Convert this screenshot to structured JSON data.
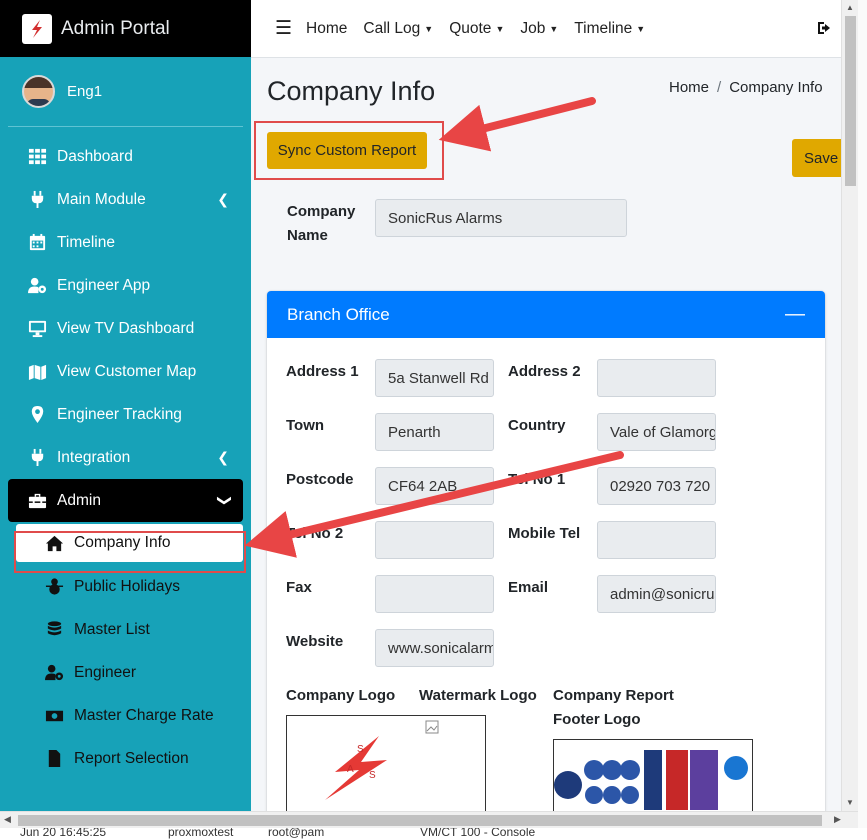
{
  "brand": {
    "title": "Admin Portal"
  },
  "user": {
    "name": "Eng1"
  },
  "sidebar": {
    "items": [
      {
        "label": "Dashboard",
        "icon": "dashboard-icon"
      },
      {
        "label": "Main Module",
        "icon": "plug-icon"
      },
      {
        "label": "Timeline",
        "icon": "calendar-icon"
      },
      {
        "label": "Engineer App",
        "icon": "user-cog-icon"
      },
      {
        "label": "View TV Dashboard",
        "icon": "monitor-icon"
      },
      {
        "label": "View Customer Map",
        "icon": "map-icon"
      },
      {
        "label": "Engineer Tracking",
        "icon": "map-marker-icon"
      },
      {
        "label": "Integration",
        "icon": "plug-icon"
      },
      {
        "label": "Admin",
        "icon": "toolbox-icon"
      }
    ],
    "admin_sub": [
      {
        "label": "Company Info",
        "icon": "home-icon"
      },
      {
        "label": "Public Holidays",
        "icon": "snowman-icon"
      },
      {
        "label": "Master List",
        "icon": "database-icon"
      },
      {
        "label": "Engineer",
        "icon": "user-cog-icon"
      },
      {
        "label": "Master Charge Rate",
        "icon": "money-icon"
      },
      {
        "label": "Report Selection",
        "icon": "file-icon"
      }
    ]
  },
  "topnav": {
    "items": [
      "Home",
      "Call Log",
      "Quote",
      "Job",
      "Timeline"
    ]
  },
  "page": {
    "title": "Company Info",
    "breadcrumb": [
      "Home",
      "Company Info"
    ],
    "sync_button": "Sync Custom Report",
    "save_button": "Save",
    "company_name_label": "Company Name",
    "company_name_value": "SonicRus Alarms"
  },
  "branch": {
    "header": "Branch Office",
    "labels": {
      "address1": "Address 1",
      "address2": "Address 2",
      "town": "Town",
      "country": "Country",
      "postcode": "Postcode",
      "tel1": "Tel No 1",
      "tel2": "Tel No 2",
      "mobile": "Mobile Tel",
      "fax": "Fax",
      "email": "Email",
      "website": "Website"
    },
    "values": {
      "address1": "5a Stanwell Rd",
      "address2": "",
      "town": "Penarth",
      "country": "Vale of Glamorgan",
      "postcode": "CF64 2AB",
      "tel1": "02920 703 720",
      "tel2": "",
      "mobile": "",
      "fax": "",
      "email": "admin@sonicrus",
      "website": "www.sonicalarms"
    },
    "logo_labels": {
      "company": "Company Logo",
      "watermark": "Watermark Logo",
      "footer": "Company Report Footer Logo"
    }
  },
  "taskbar": [
    "Jun 20 16:45:25",
    "proxmoxtest",
    "root@pam",
    "VM/CT 100 - Console"
  ],
  "colors": {
    "sidebar": "#17a2b8",
    "accent_button": "#e0a800",
    "card_header": "#007bff",
    "annotation": "#e04b4b"
  }
}
